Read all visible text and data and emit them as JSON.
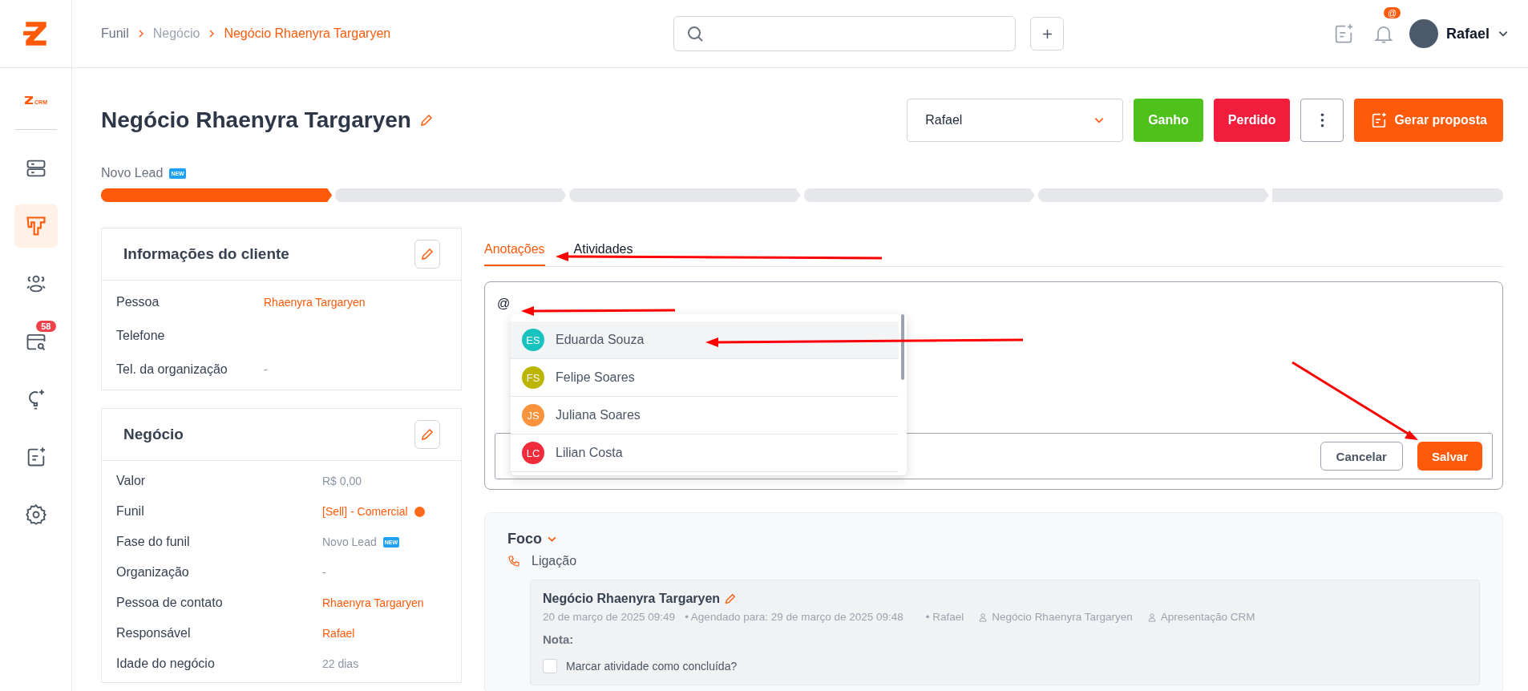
{
  "breadcrumb": [
    {
      "label": "Funil",
      "current": false
    },
    {
      "label": "Negócio",
      "current": false
    },
    {
      "label": "Negócio Rhaenyra Targaryen",
      "current": true
    }
  ],
  "topbar": {
    "mention_badge": "@",
    "user_name": "Rafael"
  },
  "sidebar": {
    "logo_text": "CRM",
    "items": [
      {
        "kind": "pipeline",
        "selected": false
      },
      {
        "kind": "deals",
        "selected": true
      },
      {
        "kind": "contacts",
        "selected": false
      },
      {
        "kind": "calendar",
        "selected": false,
        "badge": "58"
      },
      {
        "kind": "ideas",
        "selected": false
      },
      {
        "kind": "notes",
        "selected": false
      },
      {
        "kind": "settings",
        "selected": false
      }
    ]
  },
  "header": {
    "title": "Negócio Rhaenyra Targaryen",
    "owner_select": "Rafael",
    "buttons": [
      {
        "label": "Ganho",
        "kind": "won"
      },
      {
        "label": "Perdido",
        "kind": "lost"
      },
      {
        "label": "Gerar proposta",
        "kind": "proposal"
      }
    ]
  },
  "pipeline": {
    "stage_label": "Novo Lead",
    "stage_badge": "NEW",
    "segments": [
      {
        "done": true
      },
      {
        "done": false
      },
      {
        "done": false
      },
      {
        "done": false
      },
      {
        "done": false
      },
      {
        "done": false
      }
    ]
  },
  "client_card": {
    "title": "Informações do cliente",
    "fields": [
      {
        "label": "Pessoa",
        "value": "Rhaenyra Targaryen",
        "kind": "link"
      },
      {
        "label": "Telefone",
        "kind": "empty"
      },
      {
        "label": "Tel. da organização",
        "value": "-",
        "kind": "muted"
      }
    ]
  },
  "deal_card": {
    "title": "Negócio",
    "fields": [
      {
        "label": "Valor",
        "value": "R$ 0,00",
        "kind": "muted"
      },
      {
        "label": "Funil",
        "value": "[Sell] - Comercial",
        "kind": "link",
        "color": "#ff6a1a"
      },
      {
        "label": "Fase do funil",
        "value": "Novo Lead",
        "kind": "muted",
        "badge": "NEW"
      },
      {
        "label": "Organização",
        "value": "-",
        "kind": "muted"
      },
      {
        "label": "Pessoa de contato",
        "value": "Rhaenyra Targaryen",
        "kind": "link"
      },
      {
        "label": "Responsável",
        "value": "Rafael",
        "kind": "link"
      },
      {
        "label": "Idade do negócio",
        "value": "22 dias",
        "kind": "muted"
      }
    ]
  },
  "tabs": [
    {
      "label": "Anotações",
      "selected": true
    },
    {
      "label": "Atividades",
      "selected": false
    }
  ],
  "editor": {
    "value": "@",
    "mentions": [
      {
        "initials": "ES",
        "name": "Eduarda Souza",
        "color": "#17c3bf",
        "selected": true
      },
      {
        "initials": "FS",
        "name": "Felipe Soares",
        "color": "#bdb400",
        "selected": false
      },
      {
        "initials": "JS",
        "name": "Juliana Soares",
        "color": "#fb923c",
        "selected": false
      },
      {
        "initials": "LC",
        "name": "Lilian Costa",
        "color": "#ef2b3c",
        "selected": false
      }
    ],
    "buttons": [
      {
        "label": "Cancelar",
        "kind": "secondary"
      },
      {
        "label": "Salvar",
        "kind": "primary"
      }
    ]
  },
  "focus": {
    "title": "Foco",
    "activity_type": "Ligação",
    "activity": {
      "title": "Negócio Rhaenyra Targaryen",
      "created": "20 de março de 2025 09:49",
      "scheduled": "• Agendado para: 29 de março de 2025 09:48",
      "owner": "• Rafael",
      "links": [
        "Negócio Rhaenyra Targaryen",
        "Apresentação CRM"
      ],
      "note_label": "Nota:",
      "done_label": "Marcar atividade como concluída?",
      "done": false
    }
  }
}
